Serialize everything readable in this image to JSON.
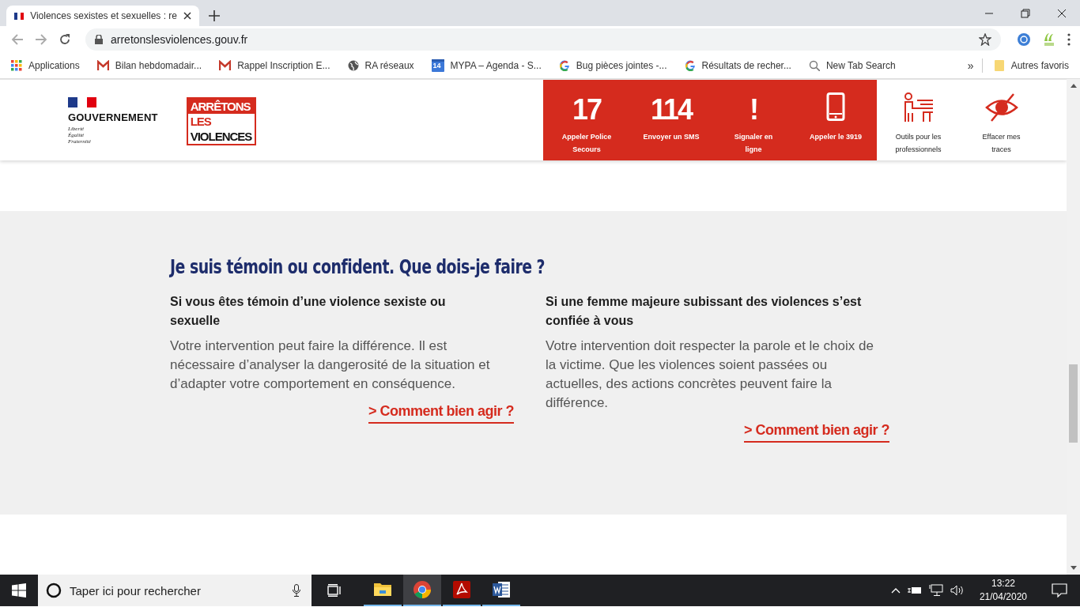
{
  "browser": {
    "tab_title": "Violences sexistes et sexuelles : re",
    "url": "arretonslesviolences.gouv.fr",
    "bookmarks": [
      {
        "kind": "apps",
        "label": "Applications"
      },
      {
        "kind": "mail",
        "label": "Bilan hebdomadair..."
      },
      {
        "kind": "mail",
        "label": "Rappel Inscription E..."
      },
      {
        "kind": "globe",
        "label": "RA réseaux"
      },
      {
        "kind": "calendar",
        "label": "MYPA – Agenda - S...",
        "badge": "14"
      },
      {
        "kind": "google",
        "label": "Bug pièces jointes -..."
      },
      {
        "kind": "google",
        "label": "Résultats de recher..."
      },
      {
        "kind": "search",
        "label": "New Tab Search"
      }
    ],
    "overflow": "»",
    "other_bookmarks": "Autres favoris"
  },
  "site_header": {
    "government": {
      "name": "GOUVERNEMENT",
      "motto": [
        "Liberté",
        "Égalité",
        "Fraternité"
      ]
    },
    "campaign_logo": [
      "ARRÊTONS",
      "LES",
      "VIOLENCES"
    ],
    "actions": [
      {
        "kind": "number",
        "value": "17",
        "label": "Appeler Police Secours"
      },
      {
        "kind": "number",
        "value": "114",
        "label": "Envoyer un SMS"
      },
      {
        "kind": "number",
        "value": "!",
        "label": "Signaler en ligne"
      },
      {
        "kind": "phone",
        "label": "Appeler le 3919"
      },
      {
        "kind": "teacher",
        "label": "Outils pour les professionnels"
      },
      {
        "kind": "hidden",
        "label": "Effacer mes traces"
      }
    ]
  },
  "witness_section": {
    "heading": "Je suis témoin ou confident. Que dois-je faire ?",
    "columns": [
      {
        "title": "Si vous êtes témoin d’une violence sexiste ou sexuelle",
        "text": "Votre intervention peut faire la différence. Il est nécessaire d’analyser la dangerosité de la situation et d’adapter votre comportement en conséquence.",
        "link": "> Comment bien agir ?"
      },
      {
        "title": "Si une femme majeure subissant des violences s’est confiée à vous",
        "text": "Votre intervention doit respecter la parole et le choix de la victime. Que les violences soient passées ou actuelles, des actions concrètes peuvent faire la différence.",
        "link": "> Comment bien agir ?"
      }
    ]
  },
  "taskbar": {
    "search_placeholder": "Taper ici pour rechercher",
    "apps": [
      {
        "kind": "explorer",
        "selected": false
      },
      {
        "kind": "chrome",
        "selected": true
      },
      {
        "kind": "pdf",
        "selected": false
      },
      {
        "kind": "word",
        "selected": false
      }
    ],
    "time": "13:22",
    "date": "21/04/2020"
  }
}
